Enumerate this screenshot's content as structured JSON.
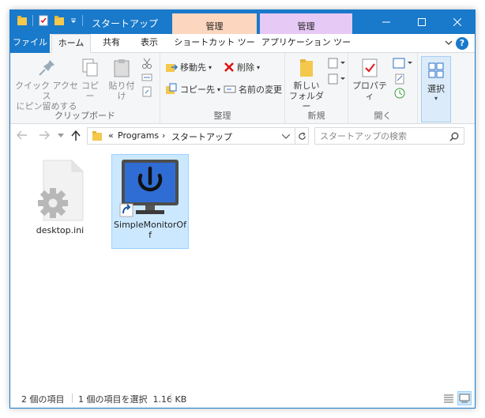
{
  "window": {
    "title": "スタートアップ"
  },
  "context_tabs": {
    "shortcut_group": "管理",
    "app_group": "管理"
  },
  "tabs": {
    "file": "ファイル",
    "home": "ホーム",
    "share": "共有",
    "view": "表示",
    "shortcut_tools": "ショートカット ツール",
    "app_tools": "アプリケーション ツール"
  },
  "ribbon": {
    "clipboard": {
      "label": "クリップボード",
      "pin_line1": "クイック アクセス",
      "pin_line2": "にピン留めする",
      "copy": "コピー",
      "paste": "貼り付け"
    },
    "organize": {
      "label": "整理",
      "move_to": "移動先",
      "copy_to": "コピー先",
      "delete": "削除",
      "rename": "名前の変更"
    },
    "new": {
      "label": "新規",
      "new_folder_line1": "新しい",
      "new_folder_line2": "フォルダー"
    },
    "open": {
      "label": "開く",
      "properties": "プロパティ"
    },
    "select": {
      "label": "選択"
    }
  },
  "address": {
    "root_chevron": "«",
    "crumb1": "Programs",
    "sep": "›",
    "crumb2": "スタートアップ"
  },
  "search": {
    "placeholder": "スタートアップの検索"
  },
  "files": [
    {
      "name": "desktop.ini",
      "icon": "settings-file-icon",
      "selected": false
    },
    {
      "name_line1": "SimpleMonitorOf",
      "name_line2": "f",
      "icon": "power-monitor-icon",
      "selected": true
    }
  ],
  "status": {
    "item_count": "2 個の項目",
    "selected_info": "1 個の項目を選択  1.16 KB"
  },
  "colors": {
    "accent": "#1979ca",
    "selection": "#cce8ff",
    "manage_orange": "#fcd6be",
    "manage_purple": "#e7c9f5"
  }
}
